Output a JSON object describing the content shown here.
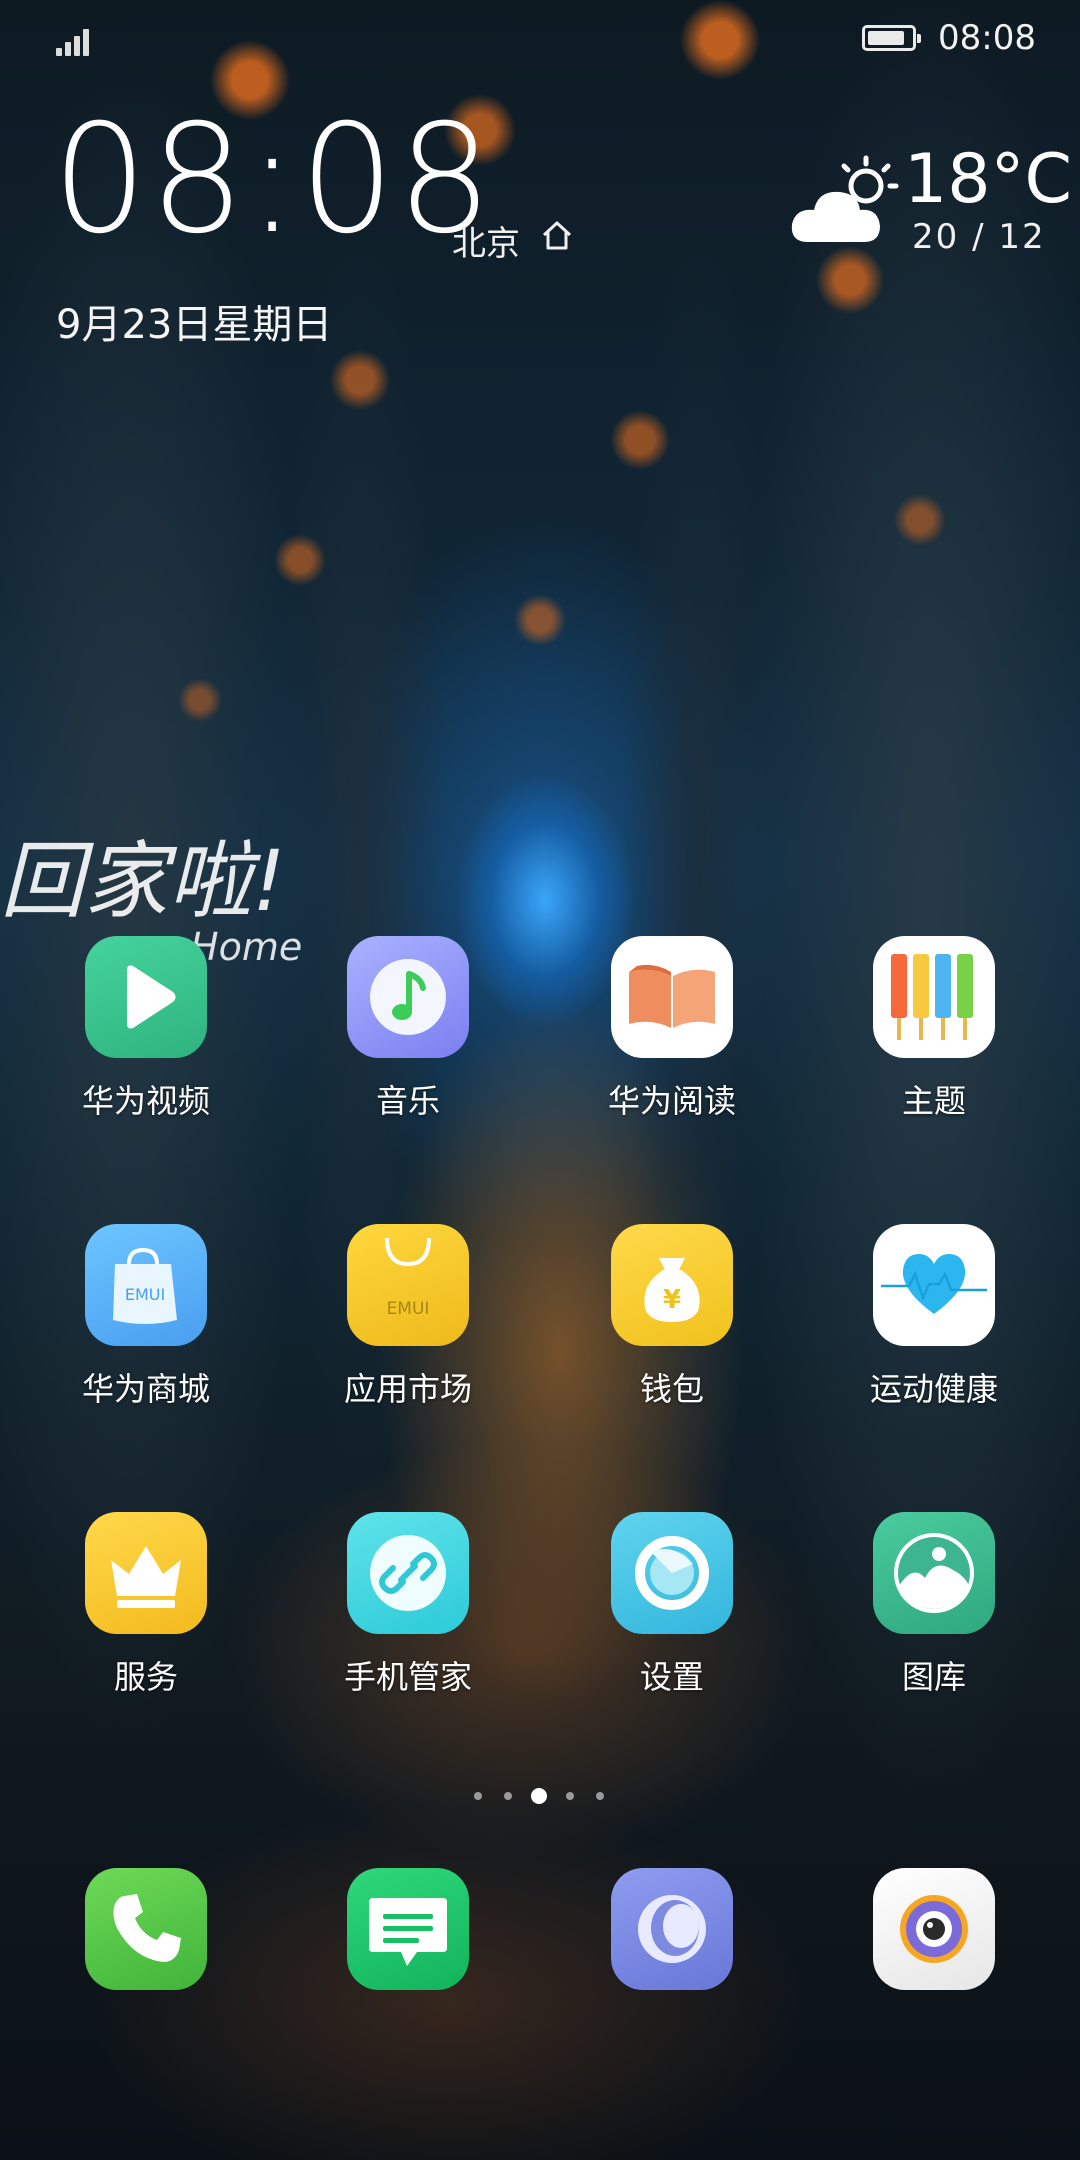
{
  "status_bar": {
    "time": "08:08",
    "signal_bars": 4,
    "battery_level": 0.85
  },
  "clock_widget": {
    "time": "08:08",
    "city": "北京",
    "date": "9月23日星期日"
  },
  "weather_widget": {
    "temperature": "18°C",
    "range": "20 / 12",
    "icon": "partly-cloudy-icon"
  },
  "wallpaper": {
    "watermark_text": "回家啦!",
    "watermark_sub": "Home"
  },
  "apps": [
    {
      "label": "华为视频",
      "icon": "video-play-icon",
      "color": "#3cc28f"
    },
    {
      "label": "音乐",
      "icon": "music-note-icon",
      "color": "#8f95f5"
    },
    {
      "label": "华为阅读",
      "icon": "open-book-icon",
      "color": "#ffffff"
    },
    {
      "label": "主题",
      "icon": "paint-brushes-icon",
      "color": "#ffffff"
    },
    {
      "label": "华为商城",
      "icon": "shopping-bag-icon",
      "color": "#5aaef5"
    },
    {
      "label": "应用市场",
      "icon": "app-market-bag-icon",
      "color": "#f2c227"
    },
    {
      "label": "钱包",
      "icon": "money-bag-icon",
      "color": "#f5c93a"
    },
    {
      "label": "运动健康",
      "icon": "heart-rate-icon",
      "color": "#ffffff"
    },
    {
      "label": "服务",
      "icon": "crown-icon",
      "color": "#f7c72e"
    },
    {
      "label": "手机管家",
      "icon": "link-shield-icon",
      "color": "#48d6e2"
    },
    {
      "label": "设置",
      "icon": "settings-ring-icon",
      "color": "#43c3e0"
    },
    {
      "label": "图库",
      "icon": "gallery-icon",
      "color": "#3db68f"
    }
  ],
  "icon_text": {
    "emui": "EMUI",
    "yen": "¥"
  },
  "page_indicator": {
    "count": 5,
    "active_index": 2
  },
  "dock": [
    {
      "icon": "phone-icon",
      "color": "#55c64a"
    },
    {
      "icon": "messages-icon",
      "color": "#21c56a"
    },
    {
      "icon": "browser-icon",
      "color": "#7e8ee0"
    },
    {
      "icon": "camera-icon",
      "color": "#eeeeee"
    }
  ]
}
